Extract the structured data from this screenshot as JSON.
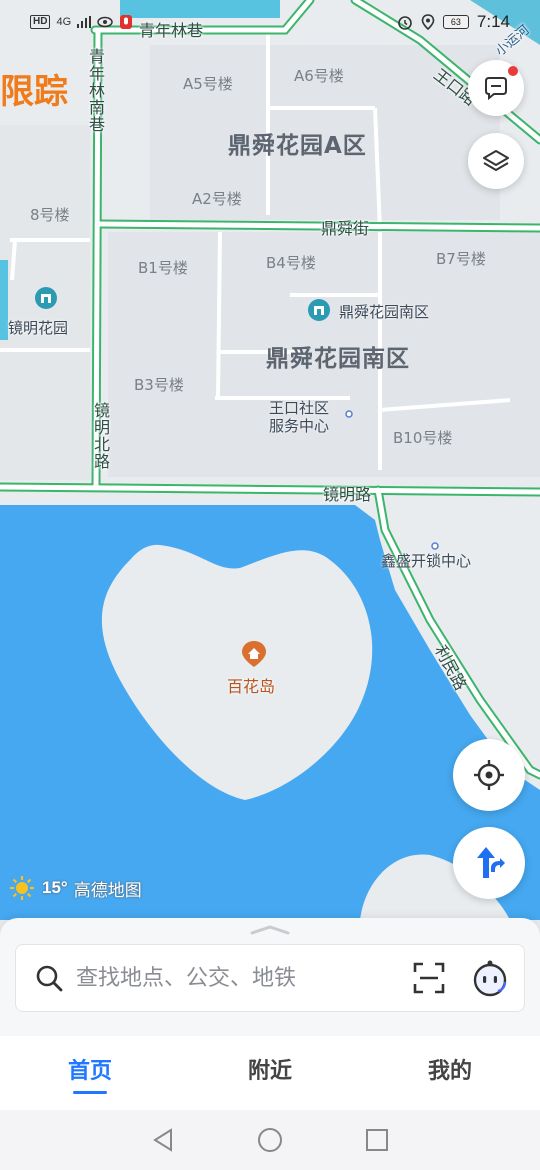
{
  "status_bar": {
    "left_text": "HD",
    "network": "4G",
    "time": "7:14",
    "battery": "63"
  },
  "map": {
    "brand_logo": "限踪",
    "buildings": [
      "A5号楼",
      "A6号楼",
      "A2号楼",
      "8号楼",
      "B1号楼",
      "B4号楼",
      "B7号楼",
      "B3号楼",
      "B10号楼"
    ],
    "areas": [
      "鼎舜花园A区",
      "鼎舜花园南区"
    ],
    "roads": {
      "top": "青年林巷",
      "left_vertical": "青年林南巷",
      "middle": "鼎舜街",
      "south_vertical": "镜明北路",
      "bottom": "镜明路",
      "diagonal_top": "王口路",
      "diagonal_bottom": "利民路",
      "river": "小运河"
    },
    "pois": {
      "jingming": "镜明花园",
      "nanqu": "鼎舜花园南区",
      "service_center_line1": "王口社区",
      "service_center_line2": "服务中心",
      "xinsheng": "鑫盛开锁中心",
      "baihua": "百花岛"
    },
    "weather": {
      "temperature": "15°",
      "brand": "高德地图"
    },
    "colors": {
      "water": "#45a8f0",
      "land": "#e9ecef",
      "road_green": "#3bb56c",
      "poi_teal": "#2a9bb3",
      "island_poi": "#d9702f"
    }
  },
  "buttons": {
    "message_icon": "message-icon",
    "layers_icon": "layers-icon",
    "locate_icon": "locate-icon",
    "navigate_icon": "navigate-icon"
  },
  "search": {
    "placeholder": "查找地点、公交、地铁"
  },
  "tabs": [
    {
      "label": "首页",
      "active": true
    },
    {
      "label": "附近",
      "active": false
    },
    {
      "label": "我的",
      "active": false
    }
  ],
  "nav_bar": [
    "back-icon",
    "home-icon",
    "recents-icon"
  ]
}
